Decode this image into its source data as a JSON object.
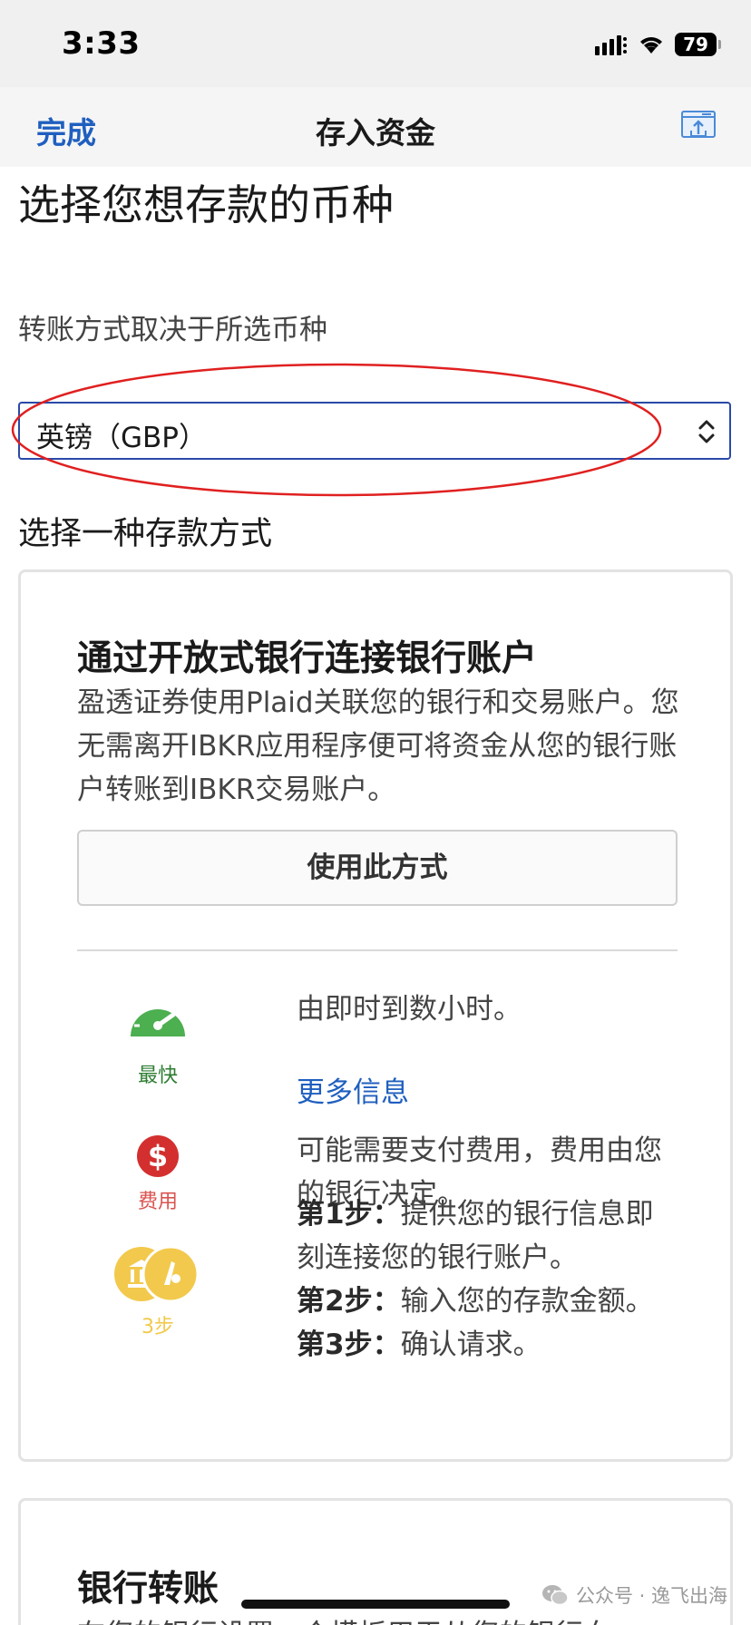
{
  "status_bar": {
    "time": "3:33",
    "battery": "79"
  },
  "nav": {
    "done_label": "完成",
    "title": "存入资金",
    "action_icon": "share-screen-icon"
  },
  "heading": "选择您想存款的币种",
  "currency_hint": "转账方式取决于所选币种",
  "currency_select": {
    "value": "英镑（GBP）"
  },
  "annotation_color": "#e02020",
  "methods_label": "选择一种存款方式",
  "open_banking_card": {
    "title": "通过开放式银行连接银行账户",
    "description": "盈透证券使用Plaid关联您的银行和交易账户。您无需离开IBKR应用程序便可将资金从您的银行账户转账到IBKR交易账户。",
    "button_label": "使用此方式",
    "speed": {
      "icon": "speedometer-icon",
      "label": "最快",
      "text": "由即时到数小时。",
      "more_link": "更多信息",
      "color": "#4caf50"
    },
    "fee": {
      "icon": "dollar-icon",
      "label": "费用",
      "text": "可能需要支付费用，费用由您的银行决定。",
      "color": "#d32f2f"
    },
    "steps": {
      "icon": "bank-steps-icon",
      "label": "3步",
      "color": "#f2c94c",
      "items": [
        {
          "step": "第1步：",
          "text": "提供您的银行信息即"
        },
        {
          "step": "",
          "text": "刻连接您的银行账户。"
        },
        {
          "step": "第2步：",
          "text": "输入您的存款金额。"
        },
        {
          "step": "第3步：",
          "text": "确认请求。"
        }
      ]
    }
  },
  "bank_transfer_card": {
    "title": "银行转账",
    "description": "在您的银行设置一个模板用于从您的银行向"
  },
  "watermark": "公众号 · 逸飞出海"
}
